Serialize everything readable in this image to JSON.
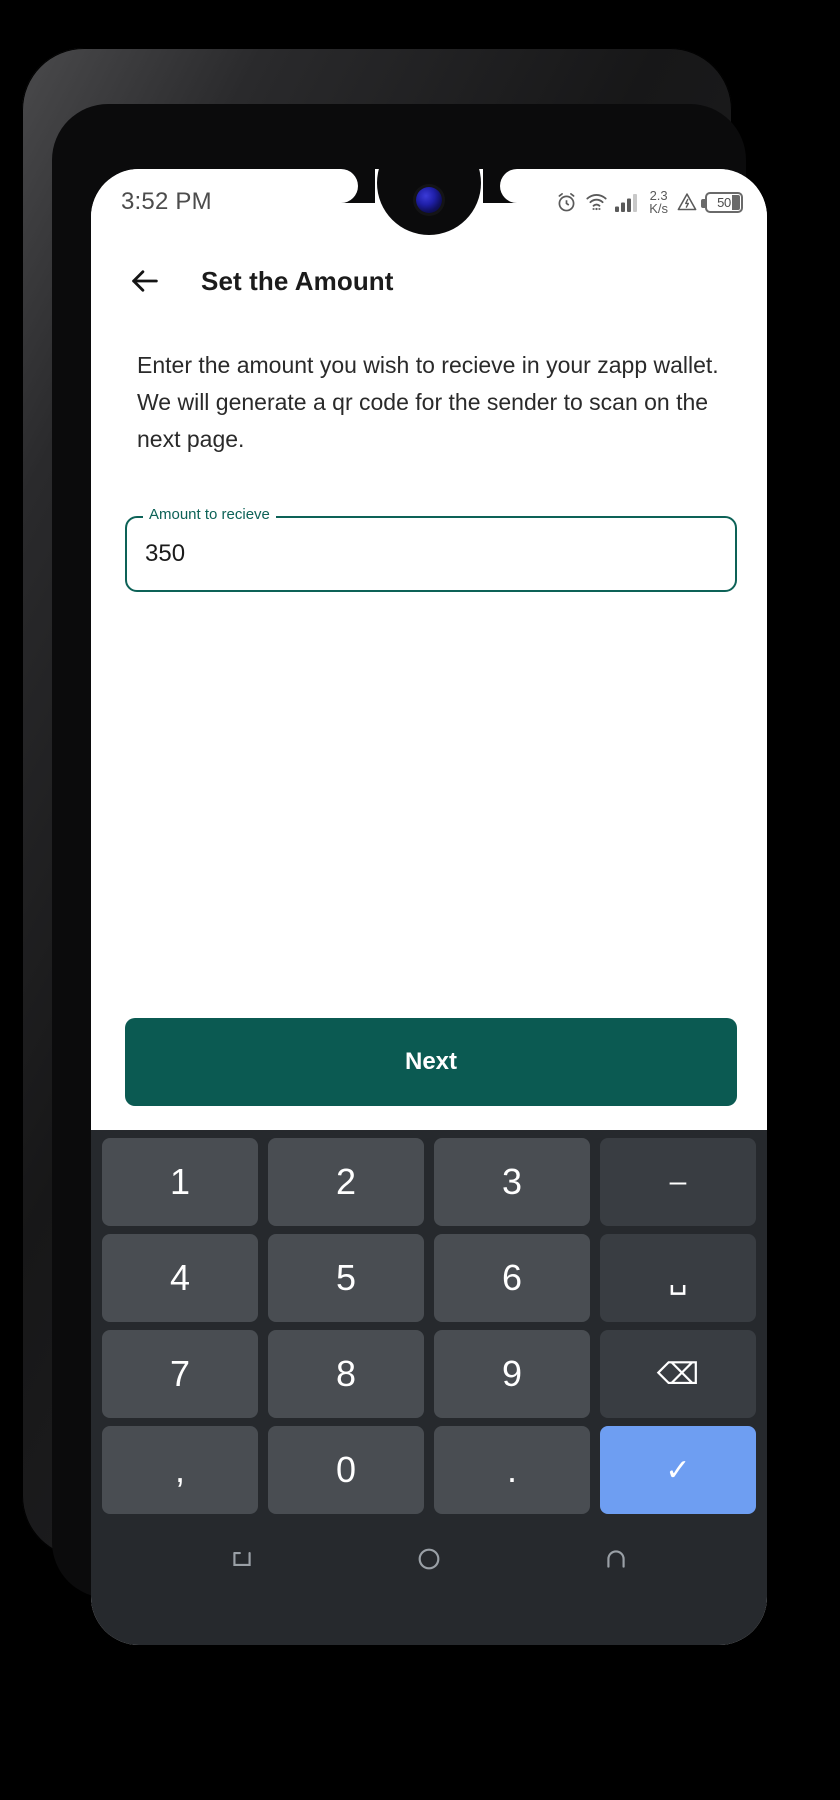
{
  "status_bar": {
    "time": "3:52 PM",
    "alarm_icon": "alarm-clock-icon",
    "wifi_icon": "wifi-icon",
    "signal_icon": "cellular-signal-icon",
    "net_speed_value": "2.3",
    "net_speed_unit": "K/s",
    "warning_icon": "triangle-alert-icon",
    "battery_level": "50"
  },
  "app": {
    "back_icon": "back-arrow-icon",
    "title": "Set the Amount",
    "description": "Enter the amount you wish to recieve in your zapp wallet. We will generate a qr code for the sender to scan on the next page.",
    "field": {
      "label": "Amount to recieve",
      "value": "350",
      "placeholder": "Amount to recieve"
    },
    "next_label": "Next"
  },
  "keyboard": {
    "rows": [
      [
        {
          "label": "1",
          "name": "key-1",
          "type": "num"
        },
        {
          "label": "2",
          "name": "key-2",
          "type": "num"
        },
        {
          "label": "3",
          "name": "key-3",
          "type": "num"
        },
        {
          "label": "–",
          "name": "key-minus",
          "type": "fn"
        }
      ],
      [
        {
          "label": "4",
          "name": "key-4",
          "type": "num"
        },
        {
          "label": "5",
          "name": "key-5",
          "type": "num"
        },
        {
          "label": "6",
          "name": "key-6",
          "type": "num"
        },
        {
          "label": "␣",
          "name": "key-space",
          "type": "fn"
        }
      ],
      [
        {
          "label": "7",
          "name": "key-7",
          "type": "num"
        },
        {
          "label": "8",
          "name": "key-8",
          "type": "num"
        },
        {
          "label": "9",
          "name": "key-9",
          "type": "num"
        },
        {
          "label": "⌫",
          "name": "key-backspace",
          "type": "fn"
        }
      ],
      [
        {
          "label": ",",
          "name": "key-comma",
          "type": "num"
        },
        {
          "label": "0",
          "name": "key-0",
          "type": "num"
        },
        {
          "label": ".",
          "name": "key-period",
          "type": "num"
        },
        {
          "label": "✓",
          "name": "key-enter",
          "type": "enter"
        }
      ]
    ]
  },
  "nav_bar": {
    "recents_icon": "recents-icon",
    "home_icon": "home-icon",
    "back_icon": "nav-back-icon"
  },
  "colors": {
    "accent": "#0b5a52",
    "field_border": "#0d6257",
    "enter_key": "#6e9ef2",
    "keyboard_bg": "#26292d",
    "key_bg": "#494d52"
  }
}
